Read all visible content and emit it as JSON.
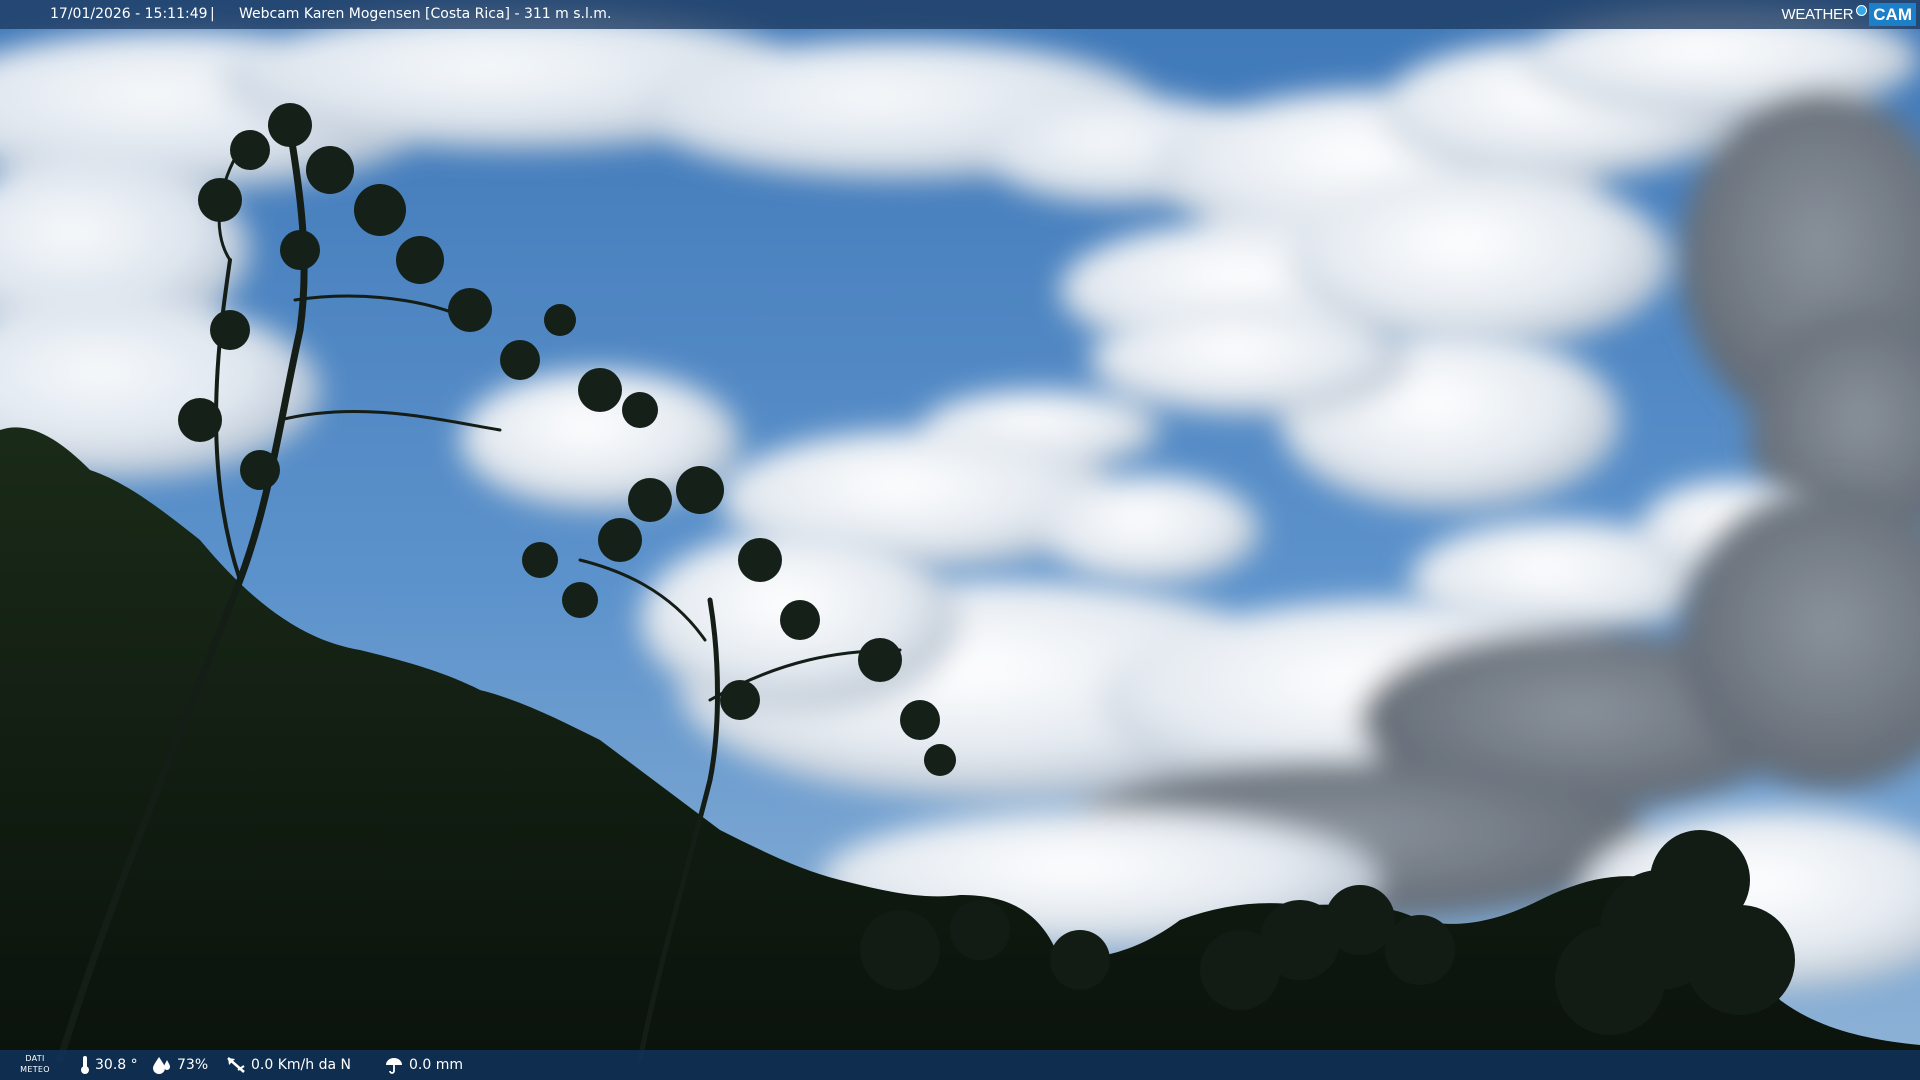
{
  "header": {
    "timestamp": "17/01/2026 - 15:11:49",
    "separator": "|",
    "title": "Webcam Karen Mogensen [Costa Rica] - 311 m s.l.m."
  },
  "brand": {
    "weather_text": "WEATHER",
    "cam_text": "CAM",
    "accent_color": "#1d7fc7"
  },
  "footer": {
    "label_line1": "DATI",
    "label_line2": "METEO",
    "temperature": "30.8 °",
    "humidity": "73%",
    "wind": "0.0 Km/h da N",
    "rain": "0.0 mm",
    "icons": [
      "thermometer-icon",
      "humidity-drop-icon",
      "wind-icon",
      "rain-umbrella-icon"
    ]
  },
  "colors": {
    "sky_blue": "#4f84c0",
    "cloud_white": "#eef3f8",
    "bar_blue": "#10345c"
  }
}
